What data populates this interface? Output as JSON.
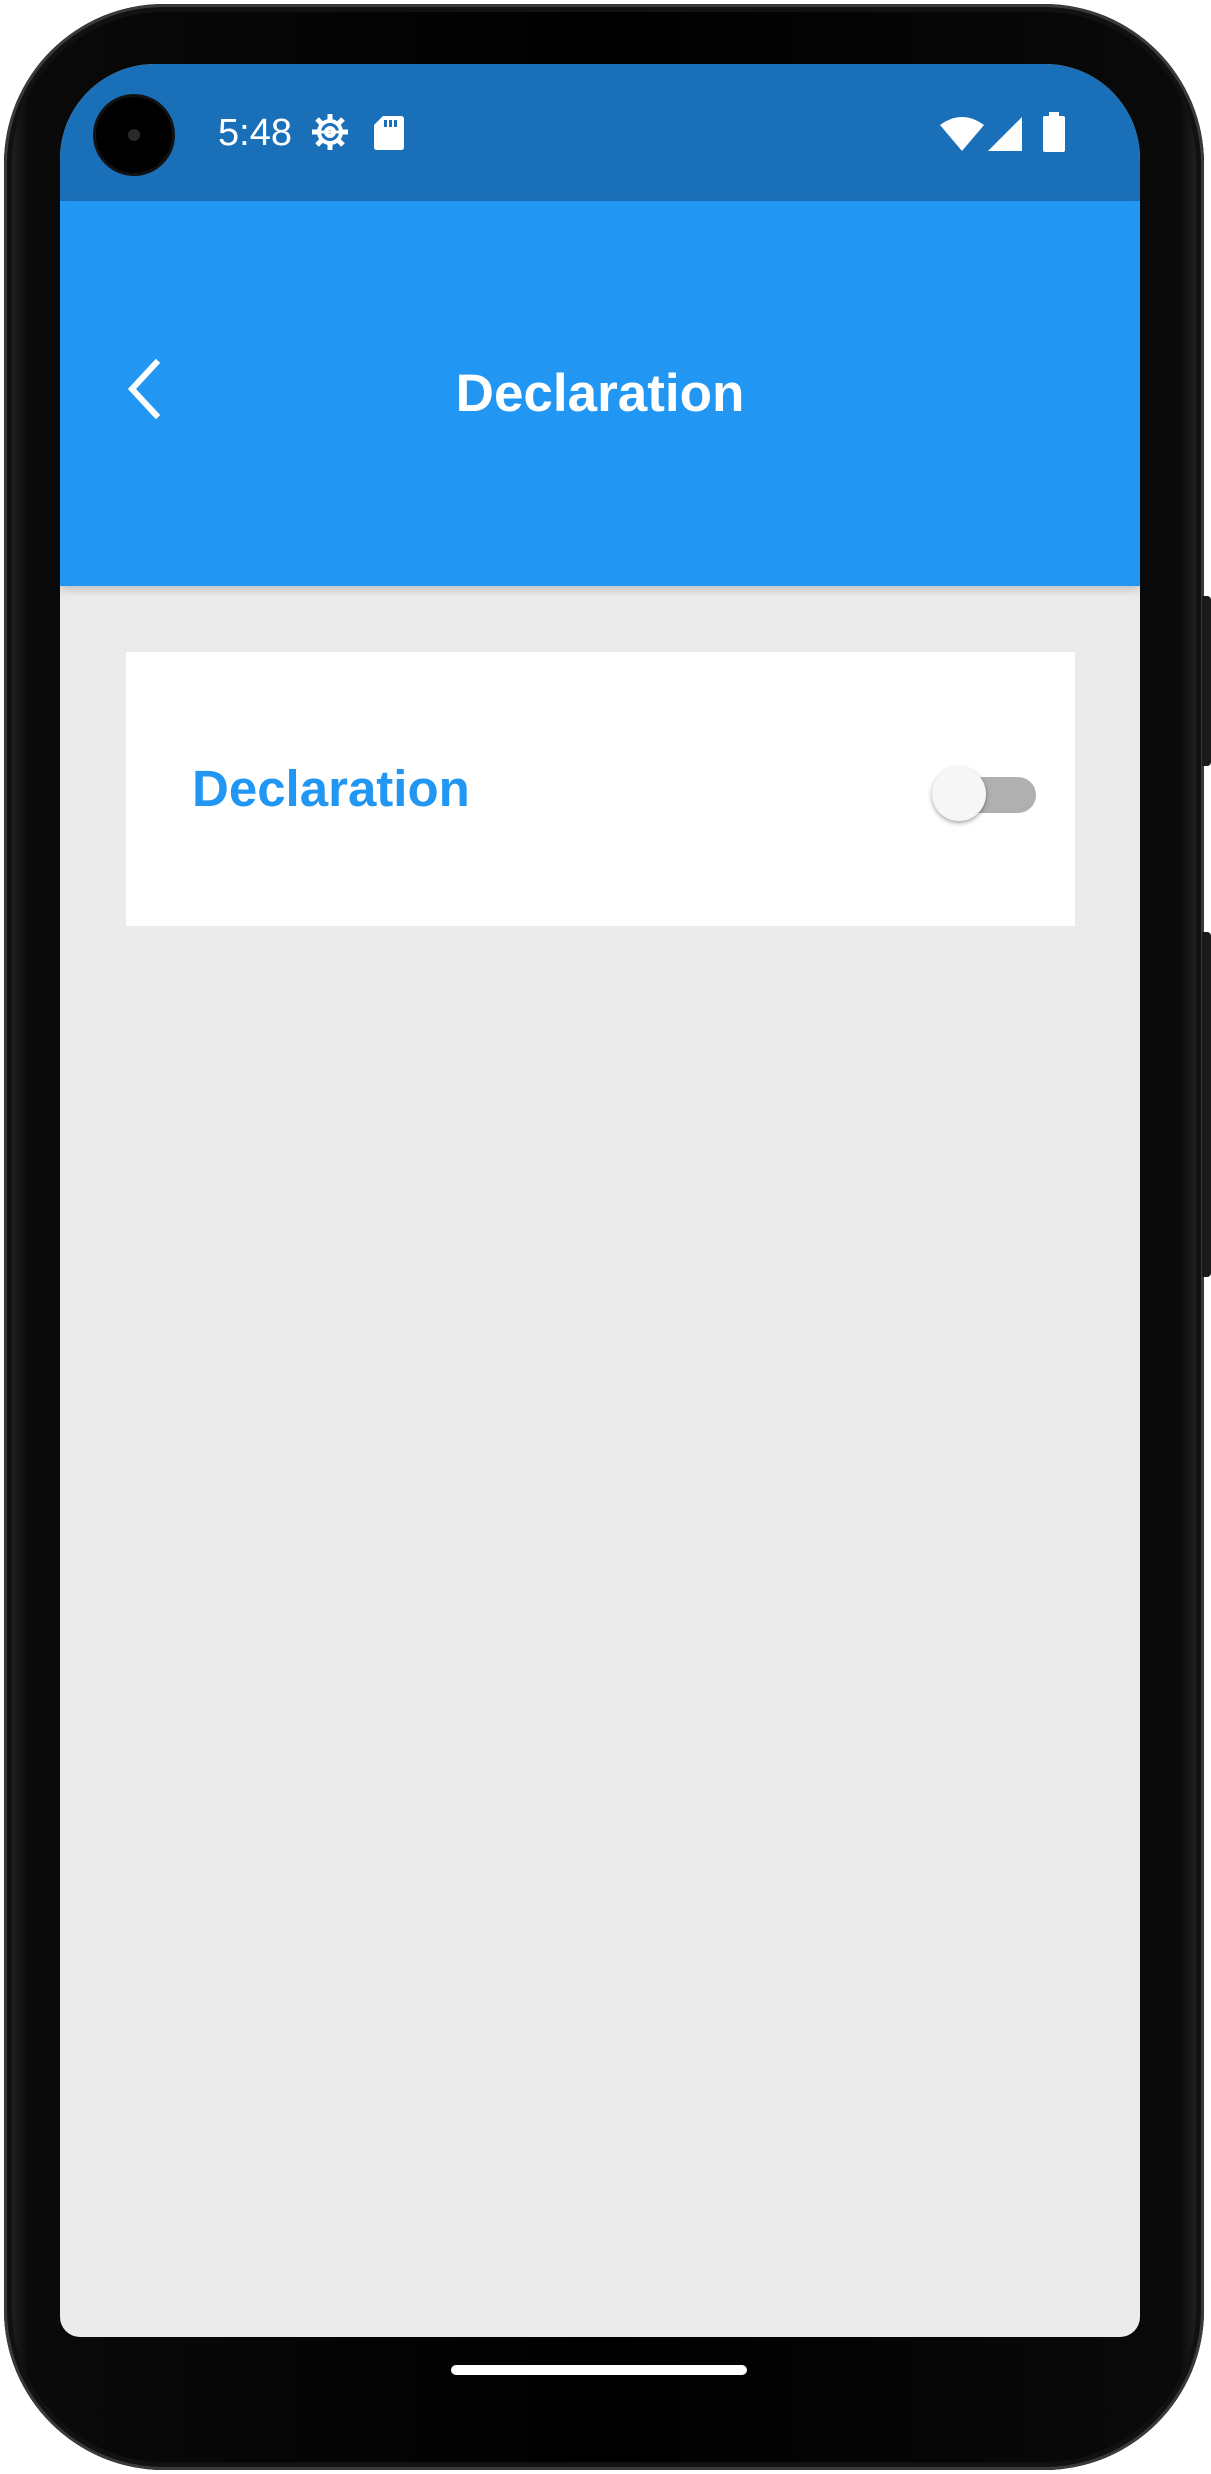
{
  "status_bar": {
    "time": "5:48",
    "icons": [
      "settings-gear-icon",
      "sd-card-icon",
      "wifi-icon",
      "cellular-signal-icon",
      "battery-icon"
    ],
    "background_color": "#1a70b8"
  },
  "app_bar": {
    "title": "Declaration",
    "back_icon": "chevron-left-icon",
    "background_color": "#2196f3"
  },
  "card": {
    "label": "Declaration",
    "label_color": "#2196f3",
    "switch_on": false
  },
  "colors": {
    "screen_background": "#ebebeb",
    "card_background": "#ffffff"
  }
}
